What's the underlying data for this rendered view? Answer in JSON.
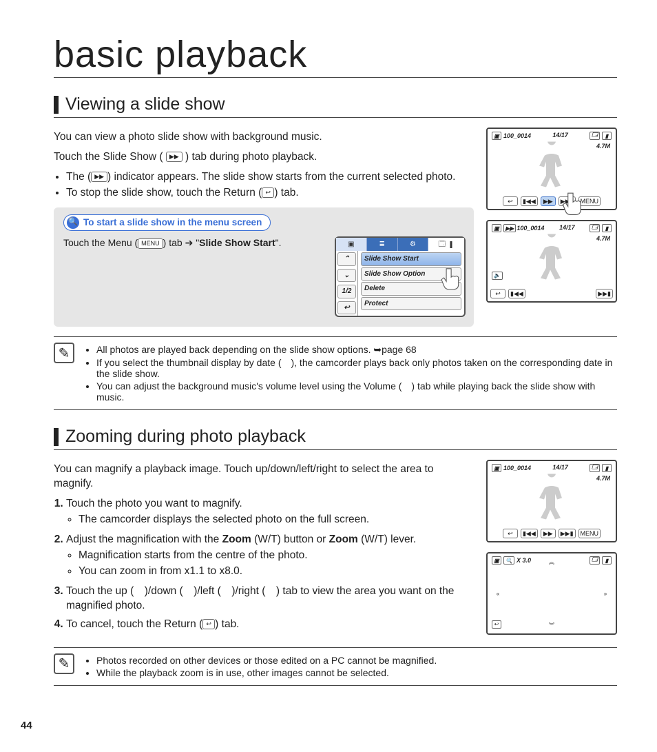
{
  "page_number": "44",
  "title": "basic playback",
  "section1": {
    "heading": "Viewing a slide show",
    "intro": "You can view a photo slide show with background music.",
    "line2a": "Touch the Slide Show (",
    "line2b": ") tab during photo playback.",
    "bullets": [
      {
        "pre": "The (",
        "post": ") indicator appears. The slide show starts from the current selected photo."
      },
      {
        "pre": "To stop the slide show, touch the Return (",
        "post": ") tab."
      }
    ],
    "tip": {
      "title": "To start a slide show in the menu screen",
      "body_pre": "Touch the Menu (",
      "body_mid": ") tab ➔ \"",
      "body_bold": "Slide Show Start",
      "body_post": "\"."
    },
    "menu": {
      "items": [
        "Slide Show Start",
        "Slide Show Option",
        "Delete",
        "Protect"
      ],
      "left": [
        "⌃",
        "⌄",
        "1/2",
        "↩"
      ]
    },
    "notes": [
      "All photos are played back depending on the slide show options. ➥page 68",
      "If you select the thumbnail display by date ( ), the camcorder plays back only photos taken on the corresponding date in the slide show.",
      "You can adjust the background music's volume level using the Volume ( ) tab while playing back the slide show with music."
    ]
  },
  "section2": {
    "heading": "Zooming during photo playback",
    "intro": "You can magnify a playback image. Touch up/down/left/right to select the area to magnify.",
    "steps": [
      {
        "text": "Touch the photo you want to magnify.",
        "sub": [
          "The camcorder displays the selected photo on the full screen."
        ]
      },
      {
        "text_pre": "Adjust the magnification with the ",
        "bold1": "Zoom",
        "text_mid": " (W/T) button or ",
        "bold2": "Zoom",
        "text_post": " (W/T) lever.",
        "sub": [
          "Magnification starts from the centre of the photo.",
          "You can zoom in from x1.1 to x8.0."
        ]
      },
      {
        "text": "Touch the up ( )/down ( )/left ( )/right ( ) tab to view the area you want on the magnified photo."
      },
      {
        "text_pre": "To cancel, touch the Return (",
        "text_post": ") tab."
      }
    ],
    "notes": [
      "Photos recorded on other devices or those edited on a PC cannot be magnified.",
      "While the playback zoom is in use, other images cannot be selected."
    ]
  },
  "cam": {
    "folder": "100_0014",
    "counter": "14/17",
    "size": "4.7M",
    "zoom_label": "X 3.0",
    "menu_label": "MENU"
  }
}
